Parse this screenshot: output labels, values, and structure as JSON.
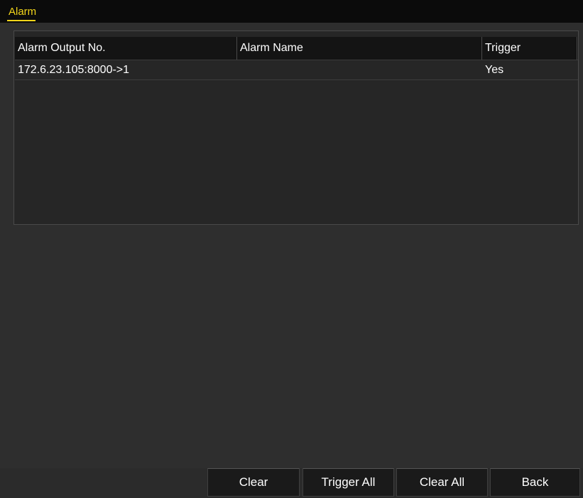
{
  "window": {
    "tab_label": "Alarm"
  },
  "table": {
    "columns": [
      "Alarm Output No.",
      "Alarm Name",
      "Trigger"
    ],
    "rows": [
      {
        "output_no": "172.6.23.105:8000->1",
        "name": "",
        "trigger": "Yes"
      }
    ]
  },
  "buttons": {
    "clear": "Clear",
    "trigger_all": "Trigger All",
    "clear_all": "Clear All",
    "back": "Back"
  },
  "colors": {
    "accent": "#f2d51a",
    "background": "#2e2e2e",
    "header_bg": "#141414",
    "button_bg": "#1a1a1a"
  }
}
